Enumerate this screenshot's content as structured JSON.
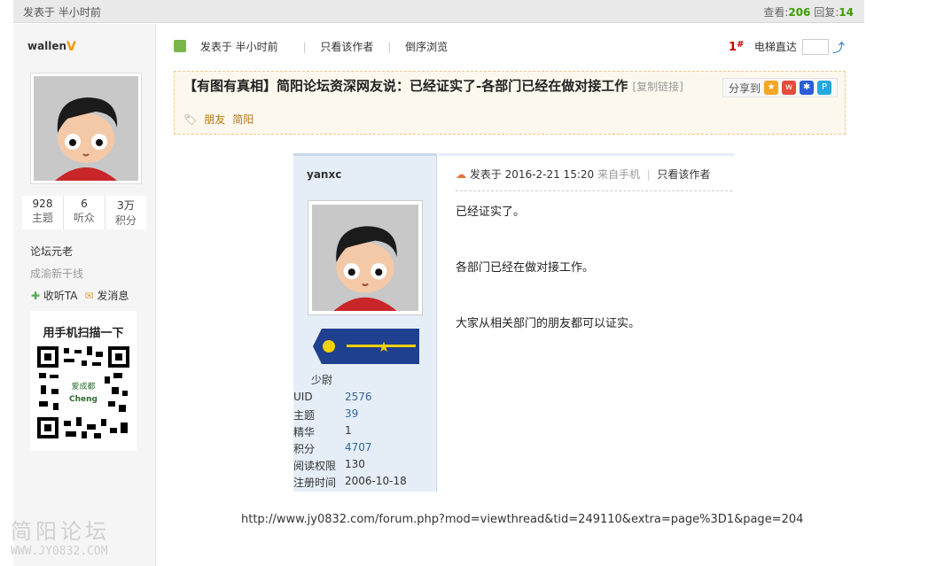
{
  "topbar": {
    "posted": "发表于  半小时前",
    "views_label": "查看:",
    "views": "206",
    "replies_label": "回复:",
    "replies": "14"
  },
  "author": {
    "name": "wallen",
    "badge": "V",
    "stats": [
      {
        "num": "928",
        "label": "主题"
      },
      {
        "num": "6",
        "label": "听众"
      },
      {
        "num": "3万",
        "label": "积分"
      }
    ],
    "rank": "论坛元老",
    "group": "成渝新干线",
    "follow": "收听TA",
    "message": "发消息"
  },
  "qr": {
    "title": "用手机扫描一下",
    "center_text_1": "爱成都",
    "center_text_2": "Cheng"
  },
  "post_tools": {
    "posted": "发表于  半小时前",
    "only_author": "只看该作者",
    "reverse": "倒序浏览",
    "floor_num": "1",
    "floor_mark": "#",
    "jump_label": "电梯直达"
  },
  "thread": {
    "title": "【有图有真相】简阳论坛资深网友说：已经证实了-各部门已经在做对接工作",
    "copy_link": "[复制链接]",
    "share_label": "分享到",
    "tags": [
      "朋友",
      "简阳"
    ]
  },
  "embedded_post": {
    "username": "yanxc",
    "rank": "少尉",
    "info": [
      {
        "key": "UID",
        "value": "2576",
        "link": true
      },
      {
        "key": "主题",
        "value": "39",
        "link": true
      },
      {
        "key": "精华",
        "value": "1",
        "link": false
      },
      {
        "key": "积分",
        "value": "4707",
        "link": true
      },
      {
        "key": "阅读权限",
        "value": "130",
        "link": false
      },
      {
        "key": "注册时间",
        "value": "2006-10-18",
        "link": false
      }
    ],
    "posted": "发表于 2016-2-21 15:20",
    "from": "来自手机",
    "only_author": "只看该作者",
    "body": [
      "已经证实了。",
      "各部门已经在做对接工作。",
      "大家从相关部门的朋友都可以证实。"
    ]
  },
  "url_text": "http://www.jy0832.com/forum.php?mod=viewthread&tid=249110&extra=page%3D1&page=204",
  "watermark": {
    "line1": "简阳论坛",
    "line2": "WWW.JY0832.COM"
  },
  "colors": {
    "accent_green": "#3c9d00",
    "link_blue": "#336699",
    "floor_red": "#cc0000",
    "tag_orange": "#b87410"
  }
}
